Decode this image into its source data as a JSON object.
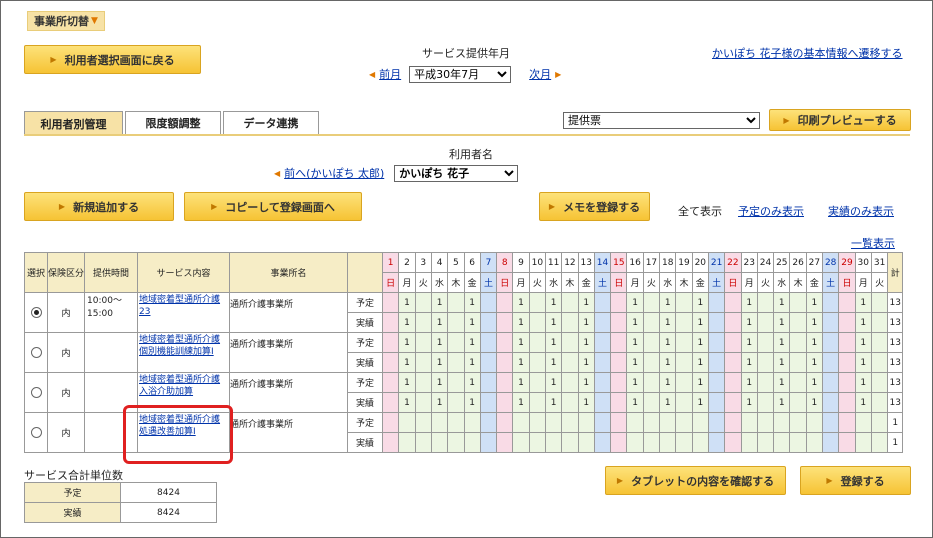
{
  "top_tag": {
    "label": "事業所切替"
  },
  "back_button": {
    "label": "利用者選択画面に戻る"
  },
  "period": {
    "heading": "サービス提供年月",
    "prev": "前月",
    "value": "平成30年7月",
    "next": "次月"
  },
  "basic_info_link": "かいぽち 花子様の基本情報へ遷移する",
  "tabs": [
    "利用者別管理",
    "限度額調整",
    "データ連携"
  ],
  "print": {
    "select_value": "提供票",
    "preview_button": "印刷プレビューする"
  },
  "user": {
    "heading": "利用者名",
    "prev_link": "前へ(かいぽち 太郎)",
    "value": "かいぽち 花子"
  },
  "actions": {
    "new_add": "新規追加する",
    "copy": "コピーして登録画面へ",
    "memo": "メモを登録する"
  },
  "filters": {
    "all": "全て表示",
    "plan_only": "予定のみ表示",
    "actual_only": "実績のみ表示"
  },
  "list_view_link": "一覧表示",
  "table": {
    "headers": {
      "select": "選択",
      "insurance": "保険区分",
      "time": "提供時間",
      "service": "サービス内容",
      "office": "事業所名",
      "total": "計"
    },
    "days": [
      "1",
      "2",
      "3",
      "4",
      "5",
      "6",
      "7",
      "8",
      "9",
      "10",
      "11",
      "12",
      "13",
      "14",
      "15",
      "16",
      "17",
      "18",
      "19",
      "20",
      "21",
      "22",
      "23",
      "24",
      "25",
      "26",
      "27",
      "28",
      "29",
      "30",
      "31"
    ],
    "weekdays": [
      "日",
      "月",
      "火",
      "水",
      "木",
      "金",
      "土",
      "日",
      "月",
      "火",
      "水",
      "木",
      "金",
      "土",
      "日",
      "月",
      "火",
      "水",
      "木",
      "金",
      "土",
      "日",
      "月",
      "火",
      "水",
      "木",
      "金",
      "土",
      "日",
      "月",
      "火"
    ],
    "rows": [
      {
        "selected": true,
        "insurance": "内",
        "time": "10:00～ 15:00",
        "service": "地域密着型通所介護23",
        "office": "通所介護事業所",
        "plan_label": "予定",
        "actual_label": "実績",
        "plan": [
          "",
          "1",
          "",
          "1",
          "",
          "1",
          "",
          "",
          "1",
          "",
          "1",
          "",
          "1",
          "",
          "",
          "1",
          "",
          "1",
          "",
          "1",
          "",
          "",
          "1",
          "",
          "1",
          "",
          "1",
          "",
          "",
          "1",
          ""
        ],
        "plan_total": "13",
        "actual": [
          "",
          "1",
          "",
          "1",
          "",
          "1",
          "",
          "",
          "1",
          "",
          "1",
          "",
          "1",
          "",
          "",
          "1",
          "",
          "1",
          "",
          "1",
          "",
          "",
          "1",
          "",
          "1",
          "",
          "1",
          "",
          "",
          "1",
          ""
        ],
        "actual_total": "13"
      },
      {
        "selected": false,
        "insurance": "内",
        "time": "",
        "service": "地域密着型通所介護個別機能訓練加算Ⅰ",
        "office": "通所介護事業所",
        "plan_label": "予定",
        "actual_label": "実績",
        "plan": [
          "",
          "1",
          "",
          "1",
          "",
          "1",
          "",
          "",
          "1",
          "",
          "1",
          "",
          "1",
          "",
          "",
          "1",
          "",
          "1",
          "",
          "1",
          "",
          "",
          "1",
          "",
          "1",
          "",
          "1",
          "",
          "",
          "1",
          ""
        ],
        "plan_total": "13",
        "actual": [
          "",
          "1",
          "",
          "1",
          "",
          "1",
          "",
          "",
          "1",
          "",
          "1",
          "",
          "1",
          "",
          "",
          "1",
          "",
          "1",
          "",
          "1",
          "",
          "",
          "1",
          "",
          "1",
          "",
          "1",
          "",
          "",
          "1",
          ""
        ],
        "actual_total": "13"
      },
      {
        "selected": false,
        "insurance": "内",
        "time": "",
        "service": "地域密着型通所介護入浴介助加算",
        "office": "通所介護事業所",
        "plan_label": "予定",
        "actual_label": "実績",
        "plan": [
          "",
          "1",
          "",
          "1",
          "",
          "1",
          "",
          "",
          "1",
          "",
          "1",
          "",
          "1",
          "",
          "",
          "1",
          "",
          "1",
          "",
          "1",
          "",
          "",
          "1",
          "",
          "1",
          "",
          "1",
          "",
          "",
          "1",
          ""
        ],
        "plan_total": "13",
        "actual": [
          "",
          "1",
          "",
          "1",
          "",
          "1",
          "",
          "",
          "1",
          "",
          "1",
          "",
          "1",
          "",
          "",
          "1",
          "",
          "1",
          "",
          "1",
          "",
          "",
          "1",
          "",
          "1",
          "",
          "1",
          "",
          "",
          "1",
          ""
        ],
        "actual_total": "13"
      },
      {
        "selected": false,
        "insurance": "内",
        "time": "",
        "service": "地域密着型通所介護処遇改善加算Ⅰ",
        "office": "通所介護事業所",
        "plan_label": "予定",
        "actual_label": "実績",
        "plan": [
          "",
          "",
          "",
          "",
          "",
          "",
          "",
          "",
          "",
          "",
          "",
          "",
          "",
          "",
          "",
          "",
          "",
          "",
          "",
          "",
          "",
          "",
          "",
          "",
          "",
          "",
          "",
          "",
          "",
          "",
          ""
        ],
        "plan_total": "1",
        "actual": [
          "",
          "",
          "",
          "",
          "",
          "",
          "",
          "",
          "",
          "",
          "",
          "",
          "",
          "",
          "",
          "",
          "",
          "",
          "",
          "",
          "",
          "",
          "",
          "",
          "",
          "",
          "",
          "",
          "",
          "",
          ""
        ],
        "actual_total": "1"
      }
    ]
  },
  "summary": {
    "title": "サービス合計単位数",
    "plan_label": "予定",
    "plan_value": "8424",
    "actual_label": "実績",
    "actual_value": "8424"
  },
  "bottom": {
    "tablet": "タブレットの内容を確認する",
    "register": "登録する"
  },
  "colors": {
    "accent": "#f6c334",
    "highlight": "#e02020",
    "saturday": "#cfe0f6",
    "sunday": "#f9dbe6"
  }
}
